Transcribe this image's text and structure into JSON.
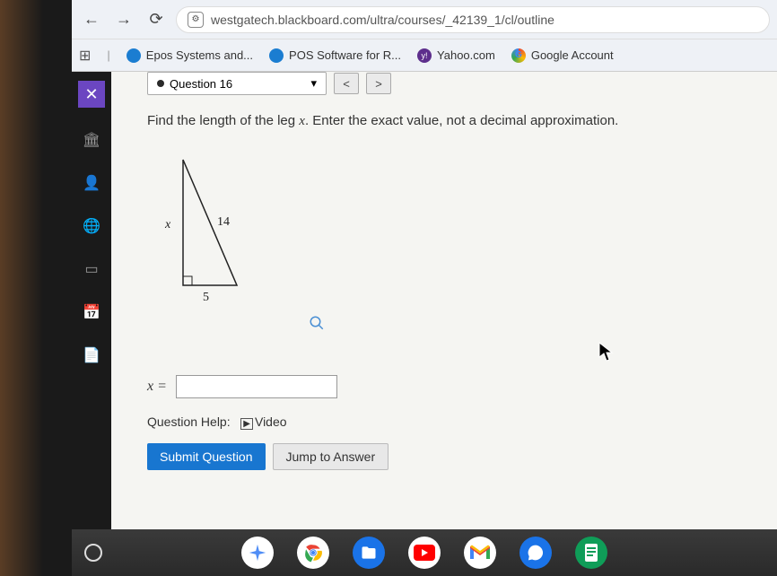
{
  "browser": {
    "url": "westgatech.blackboard.com/ultra/courses/_42139_1/cl/outline"
  },
  "bookmarks": {
    "items": [
      {
        "label": "Epos Systems and..."
      },
      {
        "label": "POS Software for R..."
      },
      {
        "label": "Yahoo.com"
      },
      {
        "label": "Google Account"
      }
    ]
  },
  "rail": {
    "close": "✕"
  },
  "question_nav": {
    "current": "Question 16"
  },
  "problem": {
    "text_before": "Find the length of the leg ",
    "var": "x",
    "text_after": ". Enter the exact value, not a decimal approximation."
  },
  "triangle": {
    "left_label": "x",
    "hyp_label": "14",
    "base_label": "5"
  },
  "answer": {
    "label": "x =",
    "value": ""
  },
  "help": {
    "label": "Question Help:",
    "video": "Video"
  },
  "buttons": {
    "submit": "Submit Question",
    "jump": "Jump to Answer"
  }
}
